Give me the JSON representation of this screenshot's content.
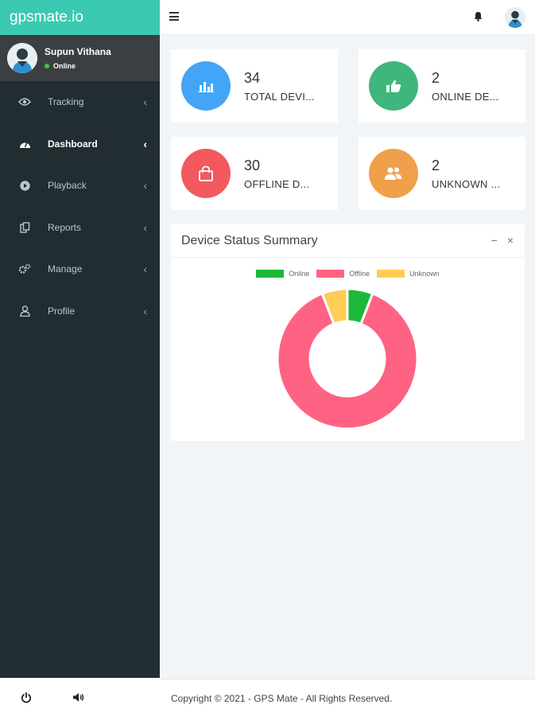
{
  "brand": {
    "name": "gpsmate.io"
  },
  "user": {
    "name": "Supun Vithana",
    "status": "Online"
  },
  "sidebar": {
    "items": [
      {
        "label": "Tracking",
        "icon": "eye-icon"
      },
      {
        "label": "Dashboard",
        "icon": "dashboard-icon",
        "active": true
      },
      {
        "label": "Playback",
        "icon": "play-icon"
      },
      {
        "label": "Reports",
        "icon": "reports-icon"
      },
      {
        "label": "Manage",
        "icon": "cogs-icon"
      },
      {
        "label": "Profile",
        "icon": "user-icon"
      }
    ],
    "chevron": "‹"
  },
  "info_boxes": [
    {
      "number": "34",
      "label": "TOTAL DEVI...",
      "color": "#42a5f5",
      "icon": "bar-chart-icon"
    },
    {
      "number": "2",
      "label": "ONLINE DE...",
      "color": "#3fb67b",
      "icon": "thumbs-up-icon"
    },
    {
      "number": "30",
      "label": "OFFLINE D...",
      "color": "#f1595f",
      "icon": "shopping-bag-icon"
    },
    {
      "number": "2",
      "label": "UNKNOWN ...",
      "color": "#f0a04b",
      "icon": "users-icon"
    }
  ],
  "chart_box": {
    "title": "Device Status Summary",
    "minimize": "−",
    "close": "×"
  },
  "chart_data": {
    "type": "pie",
    "categories": [
      "Online",
      "Offline",
      "Unknown"
    ],
    "values": [
      2,
      30,
      2
    ],
    "colors": [
      "#1db83a",
      "#ff6384",
      "#ffcd56"
    ],
    "legend_position": "top"
  },
  "footer": {
    "copyright": "Copyright © 2021 - GPS Mate - All Rights Reserved."
  }
}
